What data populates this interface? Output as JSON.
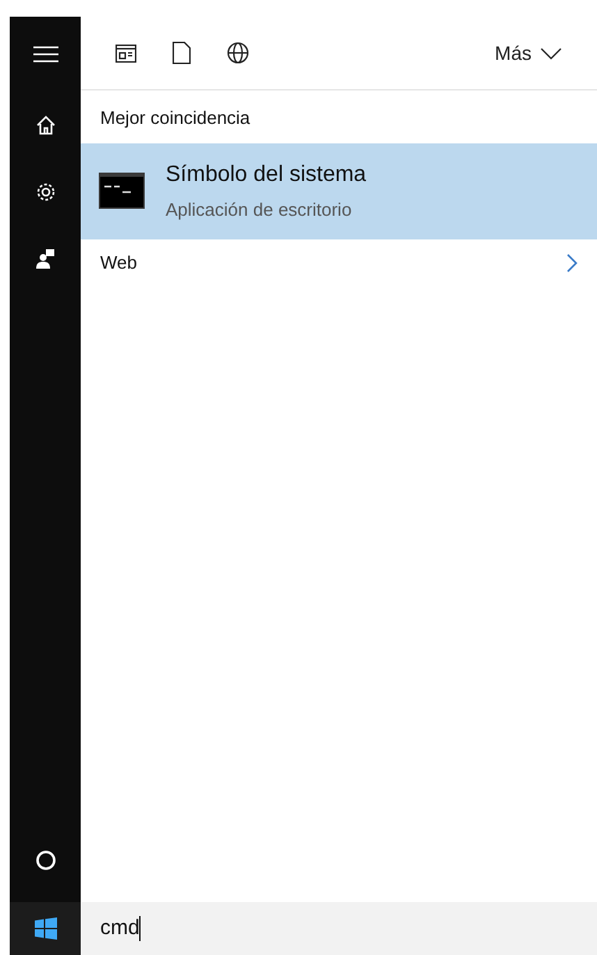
{
  "toolbar": {
    "more_label": "Más"
  },
  "section_title": "Mejor coincidencia",
  "results": [
    {
      "title": "Símbolo del sistema",
      "subtitle": "Aplicación de escritorio",
      "selected": true
    }
  ],
  "web": {
    "label": "Web"
  },
  "search": {
    "value": "cmd"
  }
}
